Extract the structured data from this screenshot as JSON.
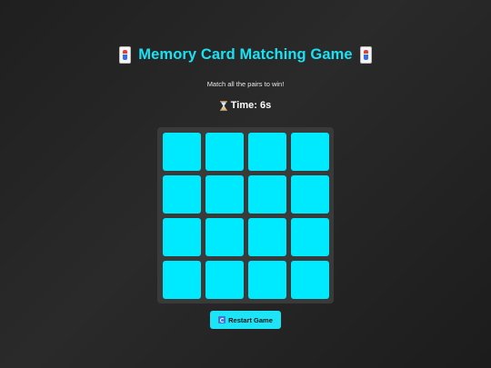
{
  "header": {
    "title": "Memory Card Matching Game",
    "title_icon": "joker-card-icon",
    "subtitle": "Match all the pairs to win!"
  },
  "timer": {
    "icon": "hourglass-icon",
    "text": "Time: 6s"
  },
  "board": {
    "rows": 4,
    "columns": 4,
    "cards": [
      {
        "state": "face-down"
      },
      {
        "state": "face-down"
      },
      {
        "state": "face-down"
      },
      {
        "state": "face-down"
      },
      {
        "state": "face-down"
      },
      {
        "state": "face-down"
      },
      {
        "state": "face-down"
      },
      {
        "state": "face-down"
      },
      {
        "state": "face-down"
      },
      {
        "state": "face-down"
      },
      {
        "state": "face-down"
      },
      {
        "state": "face-down"
      },
      {
        "state": "face-down"
      },
      {
        "state": "face-down"
      },
      {
        "state": "face-down"
      },
      {
        "state": "face-down"
      }
    ]
  },
  "controls": {
    "restart_label": "Restart Game",
    "restart_icon": "restart-icon"
  },
  "colors": {
    "accent": "#17e3f5",
    "card_back": "#00eaff",
    "board_bg": "#3a3a3a",
    "page_bg": "#242424"
  }
}
